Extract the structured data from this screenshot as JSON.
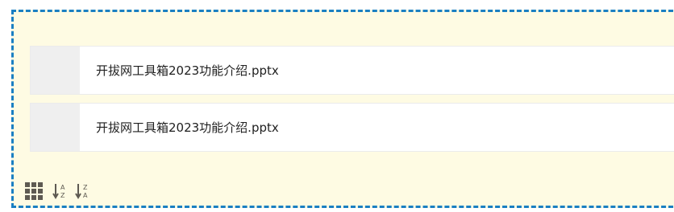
{
  "files": [
    {
      "name": "开拔网工具箱2023功能介绍.pptx"
    },
    {
      "name": "开拔网工具箱2023功能介绍.pptx"
    }
  ],
  "toolbar": {
    "icons": [
      "grid-view-icon",
      "sort-a-to-z-icon",
      "sort-z-to-a-icon"
    ]
  },
  "colors": {
    "dropzone_border": "#1a7fc2",
    "dropzone_background": "#fefbe3",
    "thumbnail_background": "#efefef",
    "icon_color": "#5e5a52"
  }
}
